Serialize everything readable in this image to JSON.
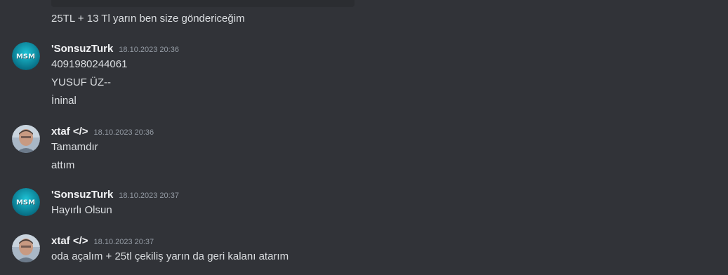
{
  "prev_message": {
    "text": "25TL + 13 Tl yarın ben size göndericeğim"
  },
  "groups": [
    {
      "username": "'SonsuzTurk",
      "timestamp": "18.10.2023 20:36",
      "avatar": "msm-logo-avatar",
      "avatar_label": "MSM",
      "lines": [
        "4091980244061",
        "YUSUF ÜZ--",
        "İninal"
      ]
    },
    {
      "username": "xtaf </>",
      "timestamp": "18.10.2023 20:36",
      "avatar": "man-photo-avatar",
      "lines": [
        "Tamamdır",
        "attım"
      ]
    },
    {
      "username": "'SonsuzTurk",
      "timestamp": "18.10.2023 20:37",
      "avatar": "msm-logo-avatar",
      "avatar_label": "MSM",
      "lines": [
        "Hayırlı Olsun"
      ]
    },
    {
      "username": "xtaf </>",
      "timestamp": "18.10.2023 20:37",
      "avatar": "man-photo-avatar",
      "lines": [
        "oda açalım + 25tl çekiliş yarın da geri kalanı atarım"
      ]
    }
  ],
  "colors": {
    "background": "#313338",
    "text": "#dbdee1",
    "username": "#f2f3f5",
    "timestamp": "#949ba4",
    "msm_avatar_bg": "#0b8fa8"
  }
}
